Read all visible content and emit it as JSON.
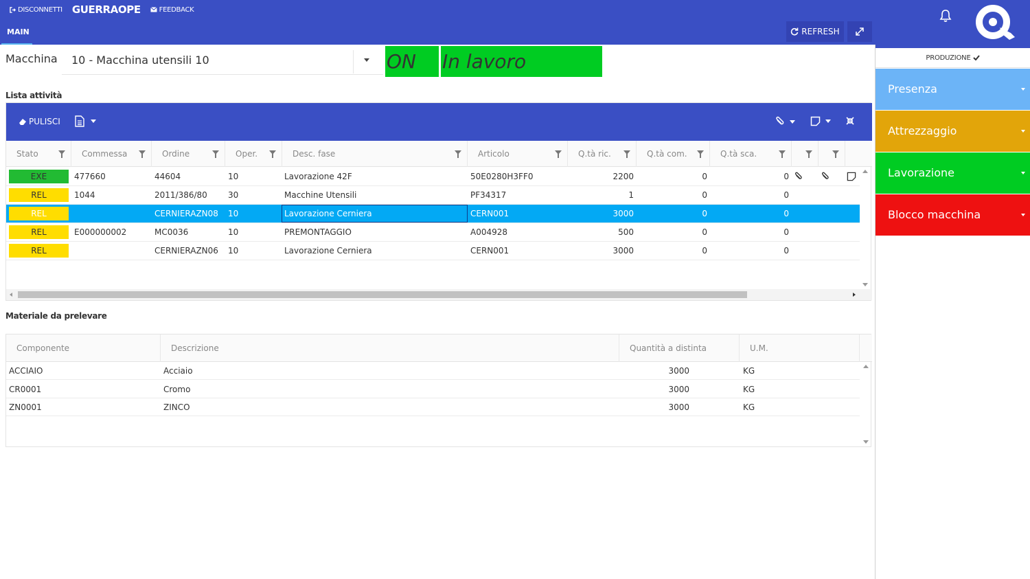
{
  "topbar": {
    "disconnect_label": "DISCONNETTI",
    "username": "GUERRAOPE",
    "feedback_label": "FEEDBACK",
    "bg_color": "#3a4fc4"
  },
  "panel": {
    "tab_label": "MAIN",
    "refresh_label": "REFRESH"
  },
  "machine": {
    "label": "Macchina",
    "selected": "10 - Macchina utensili 10",
    "power_status": "ON",
    "work_status": "In lavoro",
    "status_color": "#00cc22"
  },
  "activities": {
    "title": "Lista attività",
    "clear_label": "PULISCI",
    "columns": [
      "Stato",
      "Commessa",
      "Ordine",
      "Oper.",
      "Desc. fase",
      "Articolo",
      "Q.tà ric.",
      "Q.tà com.",
      "Q.tà sca."
    ],
    "rows": [
      {
        "stato": "EXE",
        "commessa": "477660",
        "ordine": "44604",
        "oper": "10",
        "desc": "Lavorazione 42F",
        "articolo": "50E0280H3FF0",
        "qric": "2200",
        "qcom": "0",
        "qsca": "0",
        "stato_color": "#22bb33"
      },
      {
        "stato": "REL",
        "commessa": "1044",
        "ordine": "2011/386/80",
        "oper": "30",
        "desc": "Macchine Utensili",
        "articolo": "PF34317",
        "qric": "1",
        "qcom": "0",
        "qsca": "0",
        "stato_color": "#ffdd00"
      },
      {
        "stato": "REL",
        "commessa": "",
        "ordine": "CERNIERAZN08",
        "oper": "10",
        "desc": "Lavorazione Cerniera",
        "articolo": "CERN001",
        "qric": "3000",
        "qcom": "0",
        "qsca": "0",
        "stato_color": "#ffdd00"
      },
      {
        "stato": "REL",
        "commessa": "E000000002",
        "ordine": "MC0036",
        "oper": "10",
        "desc": "PREMONTAGGIO",
        "articolo": "A004928",
        "qric": "500",
        "qcom": "0",
        "qsca": "0",
        "stato_color": "#ffdd00"
      },
      {
        "stato": "REL",
        "commessa": "",
        "ordine": "CERNIERAZN06",
        "oper": "10",
        "desc": "Lavorazione Cerniera",
        "articolo": "CERN001",
        "qric": "3000",
        "qcom": "0",
        "qsca": "0",
        "stato_color": "#ffdd00"
      }
    ],
    "selected_row_color": "#03a9f4"
  },
  "materials": {
    "title": "Materiale da prelevare",
    "columns": [
      "Componente",
      "Descrizione",
      "Quantità a distinta",
      "U.M."
    ],
    "rows": [
      {
        "componente": "ACCIAIO",
        "descrizione": "Acciaio",
        "quantita": "3000",
        "um": "KG"
      },
      {
        "componente": "CR0001",
        "descrizione": "Cromo",
        "quantita": "3000",
        "um": "KG"
      },
      {
        "componente": "ZN0001",
        "descrizione": "ZINCO",
        "quantita": "3000",
        "um": "KG"
      }
    ]
  },
  "sidebar": {
    "mode_label": "PRODUZIONE",
    "buttons": [
      {
        "label": "Presenza",
        "color": "#6cb4f7"
      },
      {
        "label": "Attrezzaggio",
        "color": "#e2a50a"
      },
      {
        "label": "Lavorazione",
        "color": "#00cc22"
      },
      {
        "label": "Blocco macchina",
        "color": "#ee1111"
      }
    ]
  }
}
